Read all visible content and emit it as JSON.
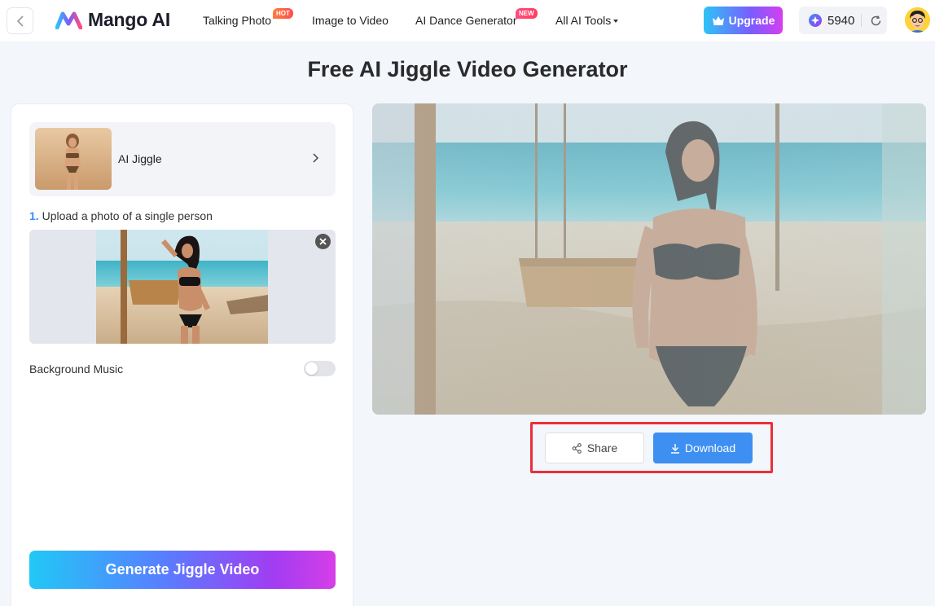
{
  "header": {
    "logo_text": "Mango AI",
    "nav": [
      {
        "label": "Talking Photo",
        "badge": "HOT"
      },
      {
        "label": "Image to Video"
      },
      {
        "label": "AI Dance Generator",
        "badge": "NEW"
      },
      {
        "label": "All AI Tools"
      }
    ],
    "upgrade_label": "Upgrade",
    "credits": "5940"
  },
  "page_title": "Free AI Jiggle Video Generator",
  "left_panel": {
    "model_label": "AI Jiggle",
    "step_number": "1.",
    "step_text": " Upload a photo of a single person",
    "music_label": "Background Music",
    "music_enabled": false,
    "generate_label": "Generate Jiggle Video"
  },
  "actions": {
    "share_label": "Share",
    "download_label": "Download"
  },
  "colors": {
    "accent_blue": "#3d8ff2",
    "highlight_red": "#ec2f3b",
    "hot_badge": "#ff6a3d",
    "new_badge": "#ff3d6a"
  }
}
